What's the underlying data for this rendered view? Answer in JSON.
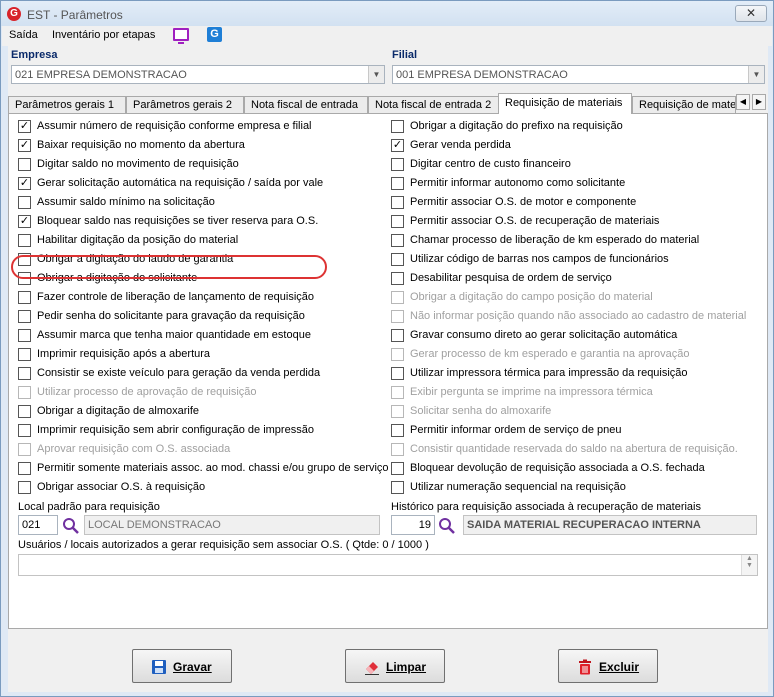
{
  "window": {
    "title": "EST - Parâmetros",
    "close_label": "✕"
  },
  "menu": {
    "items": [
      "Saída",
      "Inventário por etapas"
    ],
    "icons": [
      "monitor-icon",
      "app-g-icon"
    ]
  },
  "empresa": {
    "label": "Empresa",
    "value": "021 EMPRESA DEMONSTRACAO"
  },
  "filial": {
    "label": "Filial",
    "value": "001 EMPRESA DEMONSTRACAO"
  },
  "tabs": [
    {
      "label": "Parâmetros gerais 1"
    },
    {
      "label": "Parâmetros gerais 2"
    },
    {
      "label": "Nota fiscal de entrada"
    },
    {
      "label": "Nota fiscal de entrada 2"
    },
    {
      "label": "Requisição de materiais"
    },
    {
      "label": "Requisição de materi"
    }
  ],
  "options_left": [
    {
      "label": "Assumir número de requisição conforme empresa e filial",
      "checked": true,
      "disabled": false
    },
    {
      "label": "Baixar requisição no momento da abertura",
      "checked": true,
      "disabled": false
    },
    {
      "label": "Digitar saldo no movimento de requisição",
      "checked": false,
      "disabled": false
    },
    {
      "label": "Gerar solicitação automática na requisição / saída por vale",
      "checked": true,
      "disabled": false
    },
    {
      "label": "Assumir saldo mínimo na solicitação",
      "checked": false,
      "disabled": false
    },
    {
      "label": "Bloquear saldo nas requisições se tiver reserva para O.S.",
      "checked": true,
      "disabled": false
    },
    {
      "label": "Habilitar digitação da posição do material",
      "checked": false,
      "disabled": false
    },
    {
      "label": "Obrigar a digitação do laudo de garantia",
      "checked": false,
      "disabled": false
    },
    {
      "label": "Obrigar a digitação do solicitante",
      "checked": false,
      "disabled": false
    },
    {
      "label": "Fazer controle de liberação de lançamento de requisição",
      "checked": false,
      "disabled": false
    },
    {
      "label": "Pedir senha do solicitante para gravação da requisição",
      "checked": false,
      "disabled": false
    },
    {
      "label": "Assumir marca que tenha maior quantidade em estoque",
      "checked": false,
      "disabled": false
    },
    {
      "label": "Imprimir requisição após a abertura",
      "checked": false,
      "disabled": false
    },
    {
      "label": "Consistir se existe veículo para geração da venda perdida",
      "checked": false,
      "disabled": false
    },
    {
      "label": "Utilizar processo de aprovação de requisição",
      "checked": false,
      "disabled": true
    },
    {
      "label": "Obrigar a digitação de almoxarife",
      "checked": false,
      "disabled": false
    },
    {
      "label": "Imprimir requisição sem abrir configuração de impressão",
      "checked": false,
      "disabled": false
    },
    {
      "label": "Aprovar requisição com O.S. associada",
      "checked": false,
      "disabled": true
    },
    {
      "label": "Permitir somente materiais assoc. ao mod. chassi e/ou grupo de serviço",
      "checked": false,
      "disabled": false
    },
    {
      "label": "Obrigar associar O.S. à requisição",
      "checked": false,
      "disabled": false
    }
  ],
  "options_right": [
    {
      "label": "Obrigar a digitação do prefixo na requisição",
      "checked": false,
      "disabled": false
    },
    {
      "label": "Gerar venda perdida",
      "checked": true,
      "disabled": false
    },
    {
      "label": "Digitar centro de custo financeiro",
      "checked": false,
      "disabled": false
    },
    {
      "label": "Permitir informar autonomo como solicitante",
      "checked": false,
      "disabled": false
    },
    {
      "label": "Permitir associar O.S. de motor e componente",
      "checked": false,
      "disabled": false
    },
    {
      "label": "Permitir associar O.S. de recuperação de materiais",
      "checked": false,
      "disabled": false
    },
    {
      "label": "Chamar processo de liberação de km esperado do material",
      "checked": false,
      "disabled": false
    },
    {
      "label": "Utilizar código de barras nos campos de funcionários",
      "checked": false,
      "disabled": false
    },
    {
      "label": "Desabilitar pesquisa de ordem de serviço",
      "checked": false,
      "disabled": false
    },
    {
      "label": "Obrigar a digitação do campo posição do material",
      "checked": false,
      "disabled": true
    },
    {
      "label": "Não informar posição quando não associado ao cadastro de material",
      "checked": false,
      "disabled": true
    },
    {
      "label": "Gravar consumo direto ao gerar solicitação automática",
      "checked": false,
      "disabled": false
    },
    {
      "label": "Gerar processo de km esperado e garantia na aprovação",
      "checked": false,
      "disabled": true
    },
    {
      "label": "Utilizar impressora térmica para impressão da requisição",
      "checked": false,
      "disabled": false
    },
    {
      "label": "Exibir pergunta se imprime na impressora térmica",
      "checked": false,
      "disabled": true
    },
    {
      "label": "Solicitar senha do almoxarife",
      "checked": false,
      "disabled": true
    },
    {
      "label": "Permitir informar ordem de serviço de pneu",
      "checked": false,
      "disabled": false
    },
    {
      "label": "Consistir quantidade reservada do saldo na abertura de requisição.",
      "checked": false,
      "disabled": true
    },
    {
      "label": "Bloquear devolução de requisição associada a O.S. fechada",
      "checked": false,
      "disabled": false
    },
    {
      "label": "Utilizar numeração sequencial na requisição",
      "checked": false,
      "disabled": false
    }
  ],
  "local": {
    "label": "Local padrão para requisição",
    "code": "021",
    "desc": "LOCAL DEMONSTRACAO"
  },
  "historico": {
    "label": "Histórico para requisição associada à recuperação de materiais",
    "code": "19",
    "desc": "SAIDA MATERIAL RECUPERACAO INTERNA"
  },
  "usuarios": {
    "label": "Usuários / locais autorizados a gerar requisição sem associar O.S.  ( Qtde: 0 / 1000 )"
  },
  "buttons": {
    "gravar": "Gravar",
    "limpar": "Limpar",
    "excluir": "Excluir"
  }
}
